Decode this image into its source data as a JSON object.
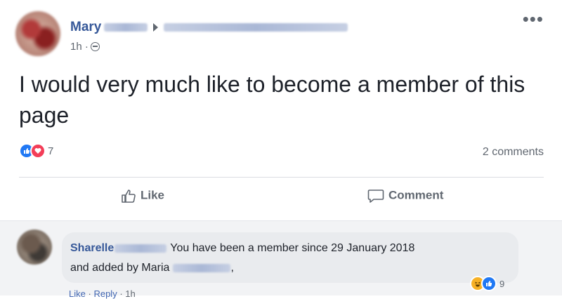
{
  "post": {
    "author_first": "Mary",
    "time": "1h",
    "time_separator": "·",
    "text": "I would very much like to become a member of this page",
    "reaction_count": "7",
    "comments_count": "2 comments",
    "actions": {
      "like": "Like",
      "comment": "Comment"
    },
    "icons": [
      "avatar",
      "chevron-right-icon",
      "globe-icon",
      "more-icon",
      "like-reaction-icon",
      "love-reaction-icon",
      "thumbs-up-icon",
      "comment-bubble-icon"
    ]
  },
  "comment": {
    "author_first": "Sharelle",
    "text_line1": "You have been a member since 29 January 2018",
    "text_line2_prefix": "and added by Maria",
    "text_line2_suffix": ",",
    "reaction_count": "9",
    "actions": {
      "like": "Like",
      "reply": "Reply",
      "separator": "·",
      "time": "1h"
    }
  },
  "colors": {
    "link": "#365899",
    "like_blue": "#2078f4",
    "love_red": "#f33e58",
    "haha_yellow": "#f7b125",
    "secondary_text": "#606770"
  }
}
